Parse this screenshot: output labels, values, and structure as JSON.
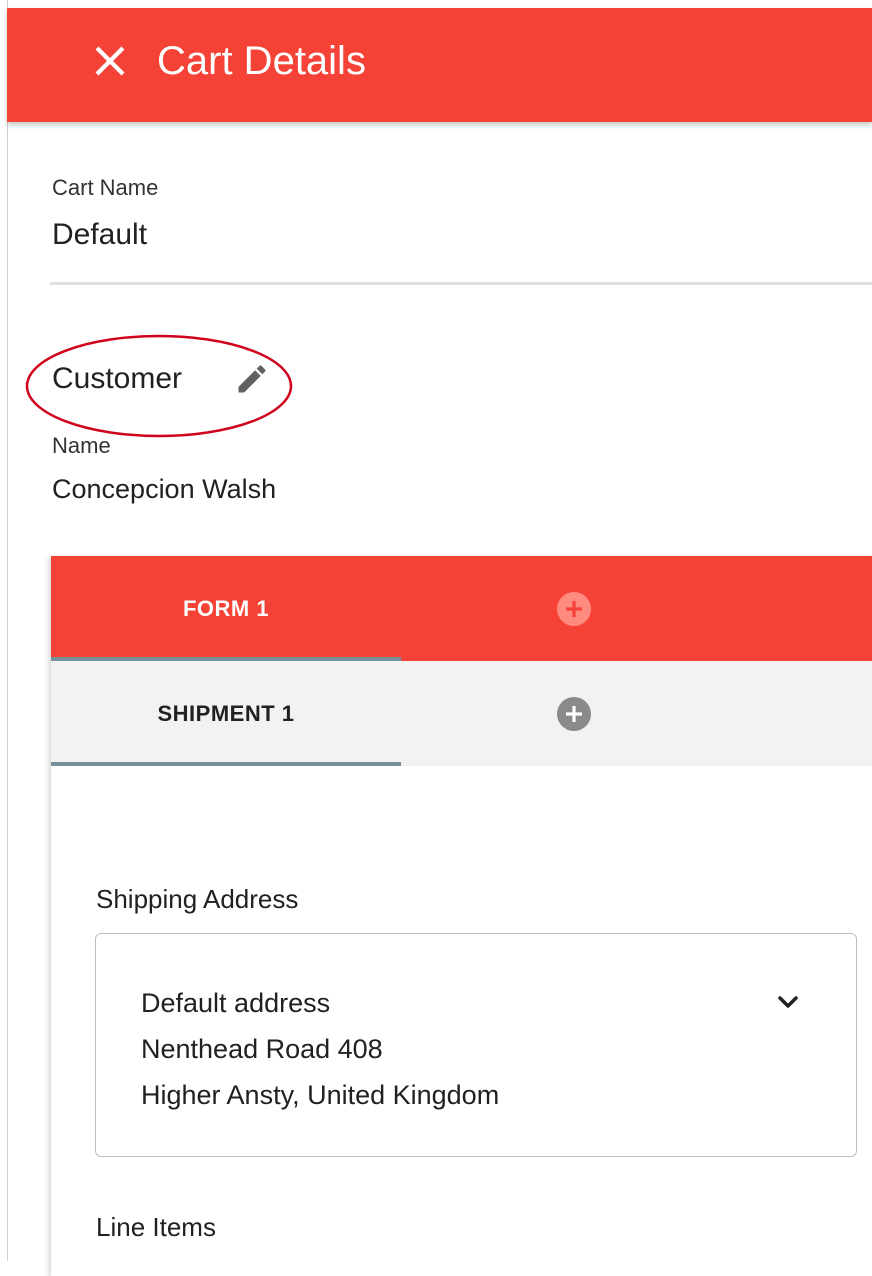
{
  "header": {
    "title": "Cart Details",
    "close_icon": "close-icon",
    "color": "#f44336"
  },
  "cart": {
    "name_label": "Cart Name",
    "name_value": "Default"
  },
  "customer": {
    "title": "Customer",
    "edit_icon": "pencil-icon",
    "name_label": "Name",
    "name_value": "Concepcion Walsh"
  },
  "forms": {
    "tabs": [
      {
        "label": "FORM 1"
      }
    ],
    "add_icon": "plus-circle-icon"
  },
  "shipments": {
    "tabs": [
      {
        "label": "SHIPMENT 1"
      }
    ],
    "add_icon": "plus-circle-icon"
  },
  "shipping": {
    "label": "Shipping Address",
    "selected": {
      "line1": "Default address",
      "line2": "Nenthead Road 408",
      "line3": "Higher Ansty, United Kingdom"
    },
    "dropdown_icon": "chevron-down-icon"
  },
  "line_items": {
    "label": "Line Items"
  },
  "colors": {
    "accent": "#f44336",
    "indicator": "#78909c",
    "annotation": "#d0021b"
  }
}
